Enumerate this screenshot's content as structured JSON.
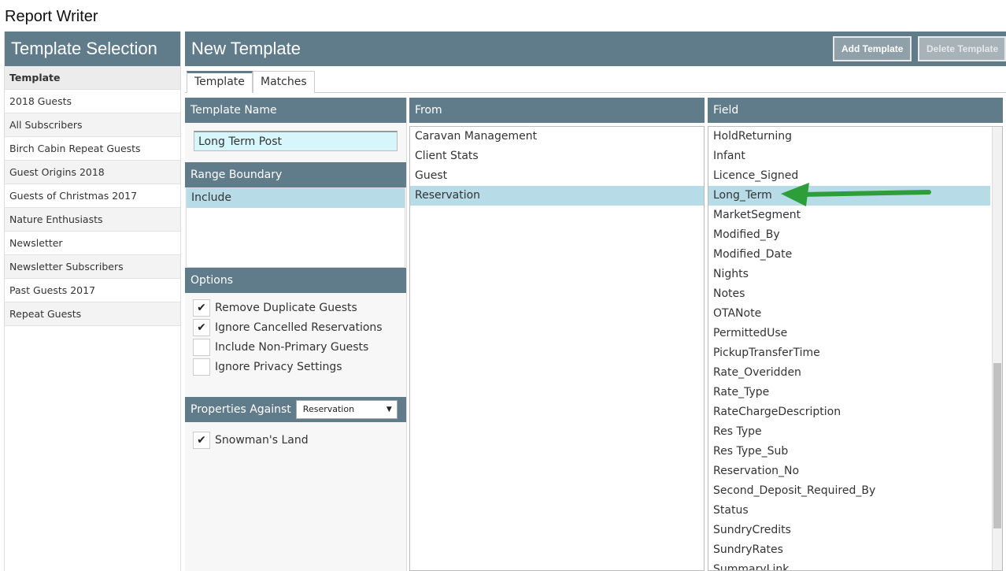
{
  "app": {
    "title": "Report Writer"
  },
  "template_selection": {
    "header": "Template Selection",
    "list_header": "Template",
    "items": [
      "2018 Guests",
      "All Subscribers",
      "Birch Cabin Repeat Guests",
      "Guest Origins 2018",
      "Guests of Christmas 2017",
      "Nature Enthusiasts",
      "Newsletter",
      "Newsletter Subscribers",
      "Past Guests 2017",
      "Repeat Guests"
    ]
  },
  "main": {
    "title": "New Template",
    "add_button": "Add Template",
    "delete_button": "Delete Template",
    "tabs": [
      "Template",
      "Matches"
    ],
    "active_tab": "Template"
  },
  "settings": {
    "template_name_label": "Template Name",
    "template_name_value": "Long Term Post",
    "range_boundary_label": "Range Boundary",
    "range_boundary_selected": "Include",
    "options_label": "Options",
    "options": [
      {
        "label": "Remove Duplicate Guests",
        "checked": true
      },
      {
        "label": "Ignore Cancelled Reservations",
        "checked": true
      },
      {
        "label": "Include Non-Primary Guests",
        "checked": false
      },
      {
        "label": "Ignore Privacy Settings",
        "checked": false
      }
    ],
    "properties_label": "Properties Against",
    "properties_select": "Reservation",
    "properties": [
      {
        "label": "Snowman's Land",
        "checked": true
      }
    ]
  },
  "from": {
    "header": "From",
    "items": [
      "Caravan Management",
      "Client Stats",
      "Guest",
      "Reservation"
    ],
    "selected": "Reservation"
  },
  "field": {
    "header": "Field",
    "items": [
      "HoldReturning",
      "Infant",
      "Licence_Signed",
      "Long_Term",
      "MarketSegment",
      "Modified_By",
      "Modified_Date",
      "Nights",
      "Notes",
      "OTANote",
      "PermittedUse",
      "PickupTransferTime",
      "Rate_Overidden",
      "Rate_Type",
      "RateChargeDescription",
      "Res Type",
      "Res Type_Sub",
      "Reservation_No",
      "Second_Deposit_Required_By",
      "Status",
      "SundryCredits",
      "SundryRates",
      "SummaryLink"
    ],
    "selected": "Long_Term"
  },
  "colors": {
    "header_bg": "#607b8a",
    "selected_bg": "#b7dce8",
    "arrow": "#2e9e3a"
  }
}
